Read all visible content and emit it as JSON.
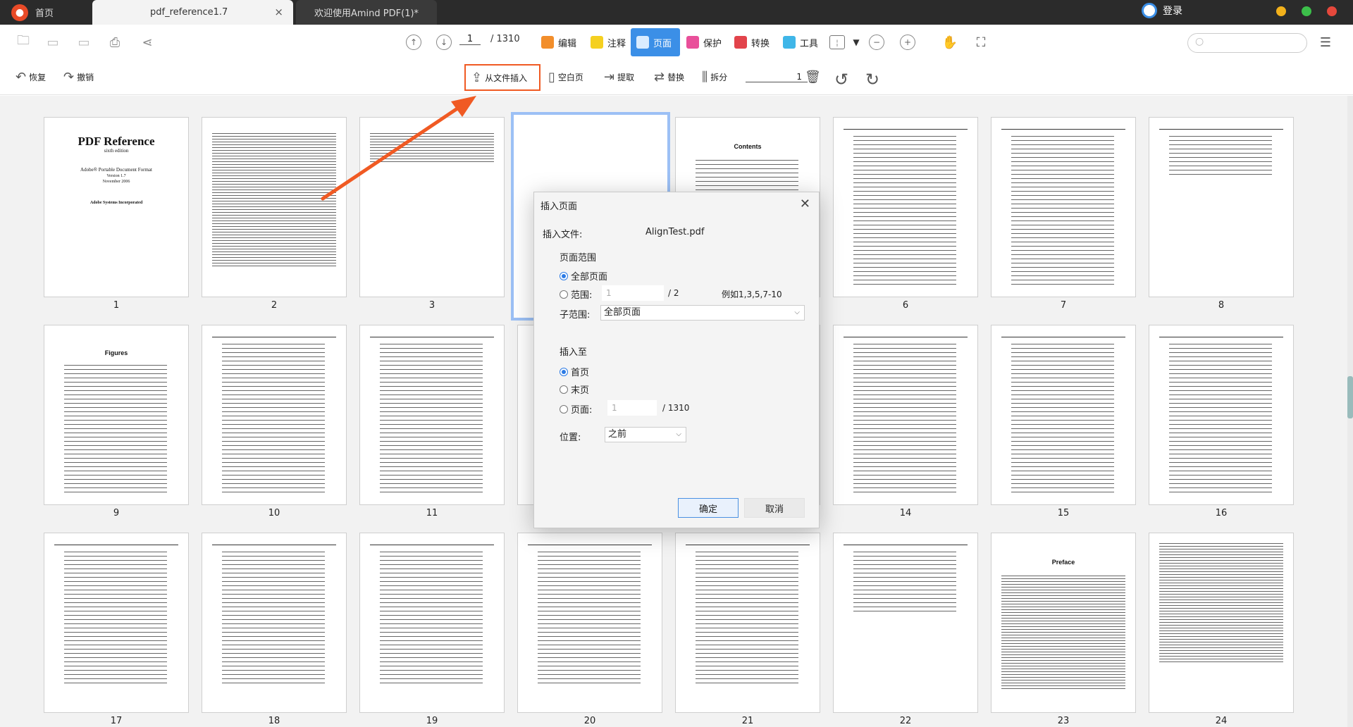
{
  "titlebar": {
    "tabs": [
      {
        "label": "首页"
      },
      {
        "label": "pdf_reference1.7",
        "close": "×"
      },
      {
        "label": "欢迎使用Amind PDF(1)*"
      }
    ],
    "login_label": "登录"
  },
  "toolbar": {
    "current_page": "1",
    "total_pages": "/ 1310",
    "menus": [
      "编辑",
      "注释",
      "页面",
      "保护",
      "转换",
      "工具"
    ],
    "active_menu": "页面"
  },
  "page_toolbar": {
    "undo": "恢复",
    "redo": "撤销",
    "insert_from_file": "从文件插入",
    "blank_page": "空白页",
    "extract": "提取",
    "replace": "替换",
    "split": "拆分",
    "split_value": "1"
  },
  "thumbnails": [
    {
      "label": "1",
      "title": "PDF Reference",
      "subtitle": "sixth edition",
      "line1": "Adobe® Portable Document Format",
      "line2": "Version 1.7",
      "line3": "November 2006",
      "line4": "Adobe Systems Incorporated"
    },
    {
      "label": "2"
    },
    {
      "label": "3"
    },
    {
      "label": ""
    },
    {
      "label": "",
      "title": "Contents"
    },
    {
      "label": "6"
    },
    {
      "label": "7"
    },
    {
      "label": "8"
    },
    {
      "label": "9",
      "title": "Figures"
    },
    {
      "label": "10"
    },
    {
      "label": "11"
    },
    {
      "label": "14"
    },
    {
      "label": "15"
    },
    {
      "label": "16"
    },
    {
      "label": "17"
    },
    {
      "label": "18"
    },
    {
      "label": "19"
    },
    {
      "label": "20"
    },
    {
      "label": "21"
    },
    {
      "label": "22"
    },
    {
      "label": "23",
      "title": "Preface"
    },
    {
      "label": "24"
    }
  ],
  "dialog": {
    "title": "插入页面",
    "insert_file_label": "插入文件:",
    "insert_file_value": "AlignTest.pdf",
    "page_range_label": "页面范围",
    "all_pages": "全部页面",
    "range_label": "范围:",
    "range_value": "1",
    "range_total": "/ 2",
    "range_example": "例如1,3,5,7-10",
    "subrange_label": "子范围:",
    "subrange_value": "全部页面",
    "insert_to_label": "插入至",
    "first_page": "首页",
    "last_page": "末页",
    "page_label": "页面:",
    "page_value": "1",
    "page_total": "/ 1310",
    "position_label": "位置:",
    "position_value": "之前",
    "ok": "确定",
    "cancel": "取消"
  },
  "colors": {
    "accent": "#3b8fe7",
    "highlight": "#f05a23",
    "titlebar": "#2b2b2b"
  }
}
